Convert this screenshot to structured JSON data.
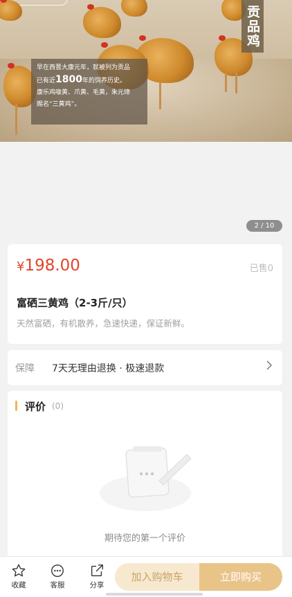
{
  "hero": {
    "badge": "贡品鸡",
    "caption_line1": "早在西晋大康元年，就被列为贡品",
    "caption_line2_pre": "已有近",
    "caption_line2_big": "1800",
    "caption_line2_post": "年的饲养历史。",
    "caption_line3": "康乐鸡喙黄、爪黄、毛黄，朱元璋",
    "caption_line4": "赐名“三黄鸡”。",
    "pager": "2 / 10"
  },
  "product": {
    "currency": "¥",
    "price": "198.00",
    "sold": "已售0",
    "title": "富硒三黄鸡（2-3斤/只）",
    "subtitle": "天然富硒，有机散养，急速快递，保证新鲜。"
  },
  "guarantee": {
    "label": "保障",
    "text": "7天无理由退换 · 极速退款"
  },
  "review": {
    "title": "评价",
    "count": "(0)",
    "empty_text": "期待您的第一个评价"
  },
  "bottom_bar": {
    "favorite": "收藏",
    "service": "客服",
    "share": "分享",
    "add_to_cart": "加入购物车",
    "buy_now": "立即购买"
  },
  "colors": {
    "price": "#e2452a",
    "accent": "#e9c489",
    "cart_bg": "#f7e9cf"
  }
}
